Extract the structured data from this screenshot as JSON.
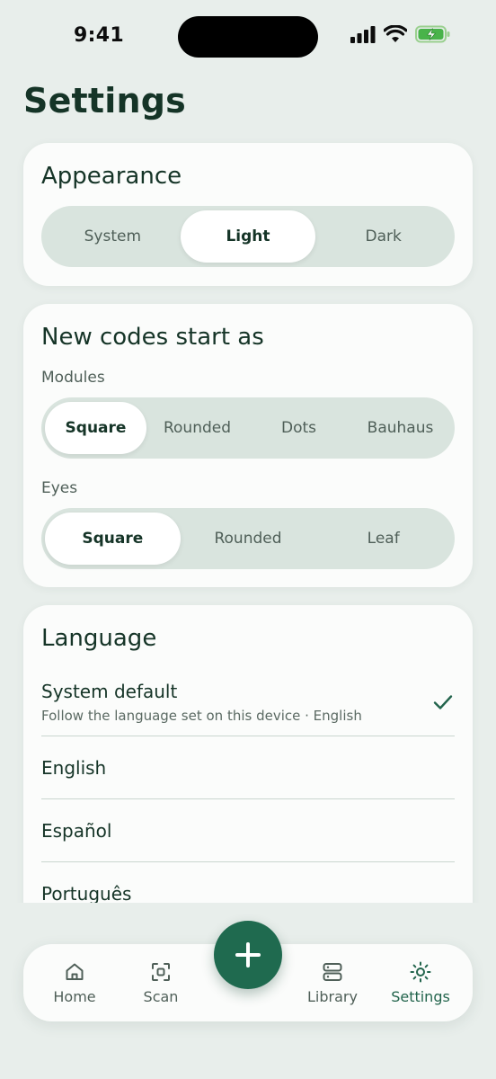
{
  "status": {
    "time": "9:41"
  },
  "page": {
    "title": "Settings"
  },
  "appearance": {
    "title": "Appearance",
    "options": [
      "System",
      "Light",
      "Dark"
    ],
    "selected": "Light"
  },
  "new_codes": {
    "title": "New codes start as",
    "modules_label": "Modules",
    "modules_options": [
      "Square",
      "Rounded",
      "Dots",
      "Bauhaus"
    ],
    "modules_selected": "Square",
    "eyes_label": "Eyes",
    "eyes_options": [
      "Square",
      "Rounded",
      "Leaf"
    ],
    "eyes_selected": "Square"
  },
  "language": {
    "title": "Language",
    "system_default": {
      "name": "System default",
      "description": "Follow the language set on this device · English",
      "checked": true
    },
    "items": [
      "English",
      "Español",
      "Português"
    ]
  },
  "tabbar": {
    "tabs": [
      {
        "label": "Home",
        "icon": "home-icon"
      },
      {
        "label": "Scan",
        "icon": "scan-icon"
      },
      {
        "label": "Library",
        "icon": "library-icon"
      },
      {
        "label": "Settings",
        "icon": "settings-icon"
      }
    ],
    "active": "Settings",
    "fab_icon": "plus-icon"
  },
  "colors": {
    "accent": "#1f6a4f",
    "background": "#e8eeeb",
    "card": "#fbfcfb",
    "segment": "#d9e4de"
  }
}
